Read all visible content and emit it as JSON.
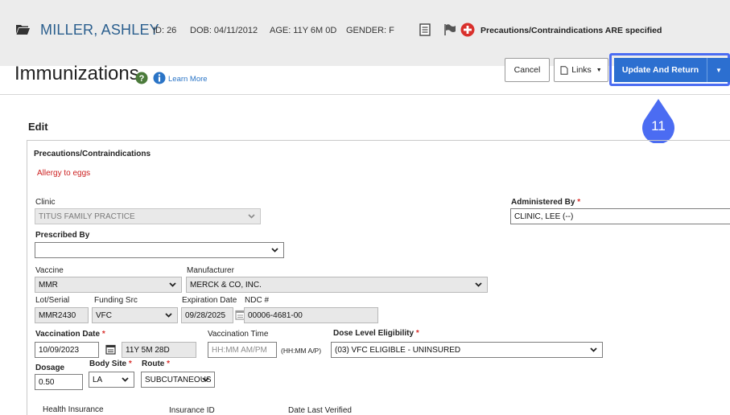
{
  "patient": {
    "name": "MILLER, ASHLEY",
    "id_label": "ID:",
    "id": "26",
    "dob_label": "DOB:",
    "dob": "04/11/2012",
    "age_label": "AGE:",
    "age": "11Y 6M 0D",
    "gender_label": "GENDER:",
    "gender": "F",
    "precautions_notice": "Precautions/Contraindications ARE specified"
  },
  "header": {
    "title": "Immunizations",
    "learn_more": "Learn More",
    "cancel_label": "Cancel",
    "links_label": "Links",
    "update_label": "Update And Return",
    "step_badge": "11"
  },
  "form": {
    "section_title": "Edit",
    "precautions_heading": "Precautions/Contraindications",
    "allergy": "Allergy to eggs",
    "clinic": {
      "label": "Clinic",
      "value": "TITUS FAMILY PRACTICE"
    },
    "administered_by": {
      "label": "Administered By",
      "value": "CLINIC, LEE (--)"
    },
    "prescribed_by": {
      "label": "Prescribed By",
      "value": ""
    },
    "vaccine": {
      "label": "Vaccine",
      "value": "MMR"
    },
    "manufacturer": {
      "label": "Manufacturer",
      "value": "MERCK & CO, INC."
    },
    "lot_serial": {
      "label": "Lot/Serial",
      "value": "MMR2430"
    },
    "funding_src": {
      "label": "Funding Src",
      "value": "VFC"
    },
    "expiration_date": {
      "label": "Expiration Date",
      "value": "09/28/2025"
    },
    "ndc": {
      "label": "NDC #",
      "value": "00006-4681-00"
    },
    "vaccination_date": {
      "label": "Vaccination Date",
      "value": "10/09/2023",
      "age_at": "11Y 5M 28D"
    },
    "vaccination_time": {
      "label": "Vaccination Time",
      "placeholder": "HH:MM AM/PM",
      "hint": "(HH:MM A/P)"
    },
    "dose_level": {
      "label": "Dose Level Eligibility",
      "value": "(03) VFC ELIGIBLE - UNINSURED"
    },
    "dosage": {
      "label": "Dosage",
      "value": "0.50"
    },
    "body_site": {
      "label": "Body Site",
      "value": "LA"
    },
    "route": {
      "label": "Route",
      "value": "SUBCUTANEOUS"
    },
    "insurance": {
      "health_insurance_label": "Health Insurance",
      "insurance_id_label": "Insurance ID",
      "date_verified_label": "Date Last Verified"
    },
    "required_marker": "*"
  },
  "colors": {
    "accent": "#2c6fd0",
    "highlight_frame": "#4b6cf2",
    "required": "#d9302c",
    "patient_name": "#2b5f8e"
  }
}
